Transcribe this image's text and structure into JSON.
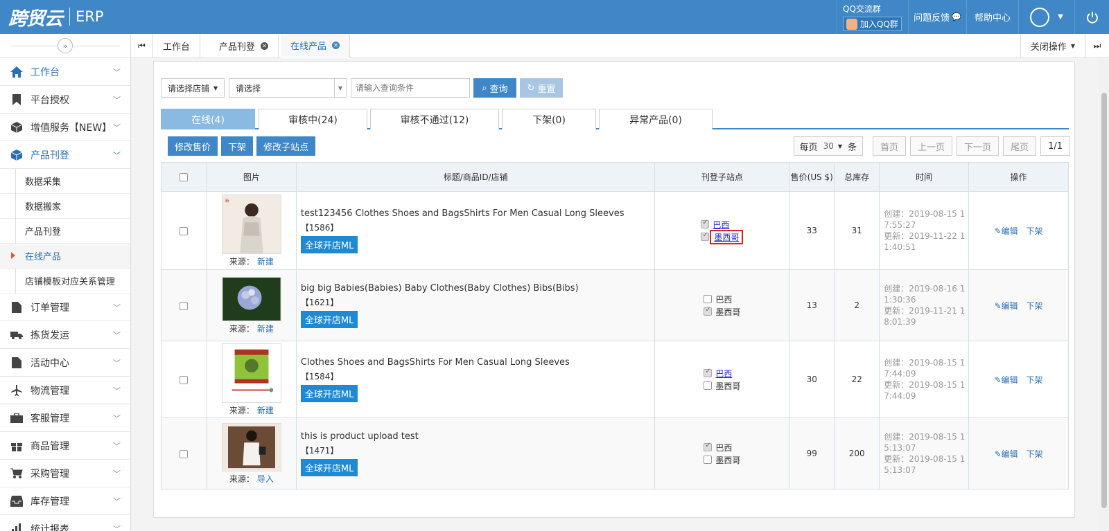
{
  "app": {
    "logo_cn": "跨贸云",
    "logo_erp": "ERP",
    "qq_group_label": "QQ交流群",
    "join_qq_label": "加入QQ群",
    "feedback_label": "问题反馈",
    "help_label": "帮助中心"
  },
  "sidebar": {
    "items": [
      {
        "label": "工作台",
        "icon": "home-icon"
      },
      {
        "label": "平台授权",
        "icon": "bookmark-icon"
      },
      {
        "label": "增值服务【NEW】",
        "icon": "box-icon"
      },
      {
        "label": "产品刊登",
        "icon": "box-icon"
      },
      {
        "label": "订单管理",
        "icon": "document-icon"
      },
      {
        "label": "拣货发运",
        "icon": "truck-icon"
      },
      {
        "label": "活动中心",
        "icon": "document-icon"
      },
      {
        "label": "物流管理",
        "icon": "plane-icon"
      },
      {
        "label": "客服管理",
        "icon": "briefcase-icon"
      },
      {
        "label": "商品管理",
        "icon": "gift-icon"
      },
      {
        "label": "采购管理",
        "icon": "cart-icon"
      },
      {
        "label": "库存管理",
        "icon": "inbox-icon"
      },
      {
        "label": "统计报表",
        "icon": "chart-icon"
      }
    ],
    "subitems": [
      "数据采集",
      "数据搬家",
      "产品刊登",
      "在线产品",
      "店铺模板对应关系管理"
    ]
  },
  "tabs": {
    "items": [
      "工作台",
      "产品刊登",
      "在线产品"
    ],
    "close_ops": "关闭操作"
  },
  "filters": {
    "store_select": "请选择店铺",
    "type_select": "请选择",
    "query_placeholder": "请输入查询条件",
    "query_btn": "查询",
    "reset_btn": "重置"
  },
  "status_tabs": [
    "在线(4)",
    "审核中(24)",
    "审核不通过(12)",
    "下架(0)",
    "异常产品(0)"
  ],
  "actions": [
    "修改售价",
    "下架",
    "修改子站点"
  ],
  "pager": {
    "per_page_prefix": "每页",
    "per_page_value": "30",
    "per_page_suffix": "条",
    "first": "首页",
    "prev": "上一页",
    "next": "下一页",
    "last": "尾页",
    "page": "1/1"
  },
  "table": {
    "headers": [
      "图片",
      "标题/商品ID/店铺",
      "刊登子站点",
      "售价(US $)",
      "总库存",
      "时间",
      "操作"
    ],
    "source_label": "来源：",
    "shop_label": "全球开店ML",
    "edit_label": "编辑",
    "offshelf_label": "下架",
    "rows": [
      {
        "title": "test123456 Clothes Shoes and BagsShirts For Men Casual Long Sleeves",
        "id": "【1586】",
        "source": "新建",
        "site1": "巴西",
        "site2": "墨西哥",
        "price": "33",
        "stock": "31",
        "time": "创建：2019-08-15 1\n7:55:27\n更新：2019-11-22 1\n1:40:51"
      },
      {
        "title": "big big Babies(Babies) Baby Clothes(Baby Clothes) Bibs(Bibs)",
        "id": "【1621】",
        "source": "新建",
        "site1": "巴西",
        "site2": "墨西哥",
        "price": "13",
        "stock": "2",
        "time": "创建：2019-08-16 1\n1:30:36\n更新：2019-11-21 1\n8:01:39"
      },
      {
        "title": "Clothes Shoes and BagsShirts For Men Casual Long Sleeves",
        "id": "【1584】",
        "source": "新建",
        "site1": "巴西",
        "site2": "墨西哥",
        "price": "30",
        "stock": "22",
        "time": "创建：2019-08-15 1\n7:44:09\n更新：2019-08-15 1\n7:44:09"
      },
      {
        "title": "this is product upload test",
        "id": "【1471】",
        "source": "导入",
        "site1": "巴西",
        "site2": "墨西哥",
        "price": "99",
        "stock": "200",
        "time": "创建：2019-08-15 1\n5:13:07\n更新：2019-08-15 1\n5:13:07"
      }
    ]
  },
  "colors": {
    "brand_blue": "#3f87c6",
    "highlight_red": "#e02020"
  }
}
